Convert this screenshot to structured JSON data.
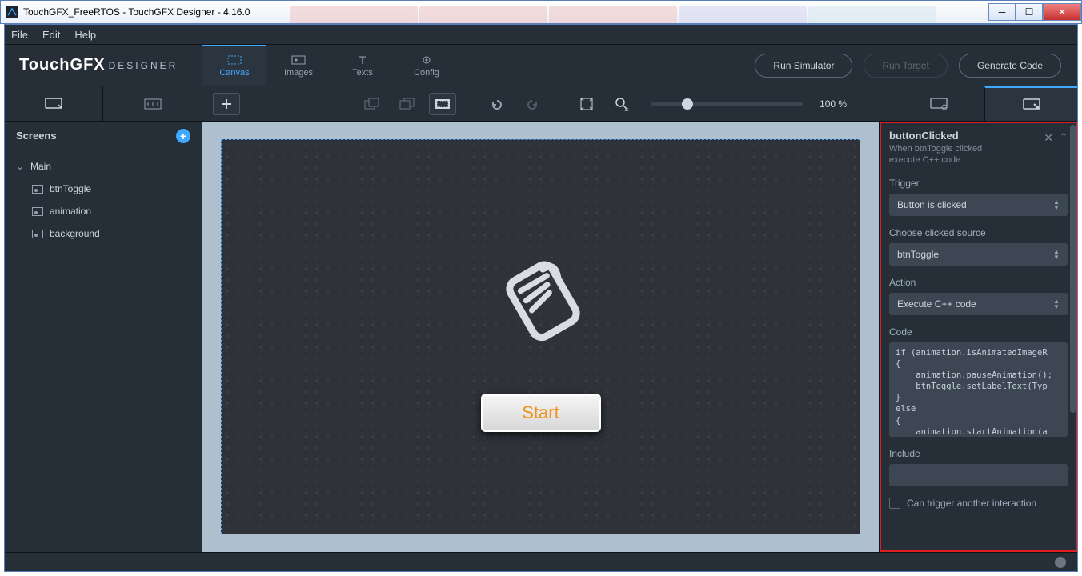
{
  "window": {
    "title": "TouchGFX_FreeRTOS - TouchGFX Designer - 4.16.0"
  },
  "menubar": {
    "file": "File",
    "edit": "Edit",
    "help": "Help"
  },
  "brand": {
    "main": "TouchGFX",
    "sub": "DESIGNER"
  },
  "modes": {
    "canvas": "Canvas",
    "images": "Images",
    "texts": "Texts",
    "config": "Config"
  },
  "actions": {
    "runSimulator": "Run Simulator",
    "runTarget": "Run Target",
    "generateCode": "Generate Code"
  },
  "toolbar": {
    "zoomPct": "100 %"
  },
  "leftpanel": {
    "heading": "Screens",
    "tree": {
      "root": "Main",
      "items": [
        "btnToggle",
        "animation",
        "background"
      ]
    }
  },
  "canvas": {
    "startLabel": "Start"
  },
  "rightpanel": {
    "interaction": {
      "name": "buttonClicked",
      "descL1": "When btnToggle clicked",
      "descL2": "execute C++ code"
    },
    "fields": {
      "triggerLabel": "Trigger",
      "triggerValue": "Button is clicked",
      "sourceLabel": "Choose clicked source",
      "sourceValue": "btnToggle",
      "actionLabel": "Action",
      "actionValue": "Execute C++ code",
      "codeLabel": "Code",
      "includeLabel": "Include",
      "canTriggerLabel": "Can trigger another interaction"
    },
    "code": "if (animation.isAnimatedImageR\n{\n    animation.pauseAnimation();\n    btnToggle.setLabelText(Typ\n}\nelse\n{\n    animation.startAnimation(a\n    btnToggle.setLabelText(Typ\n}"
  }
}
